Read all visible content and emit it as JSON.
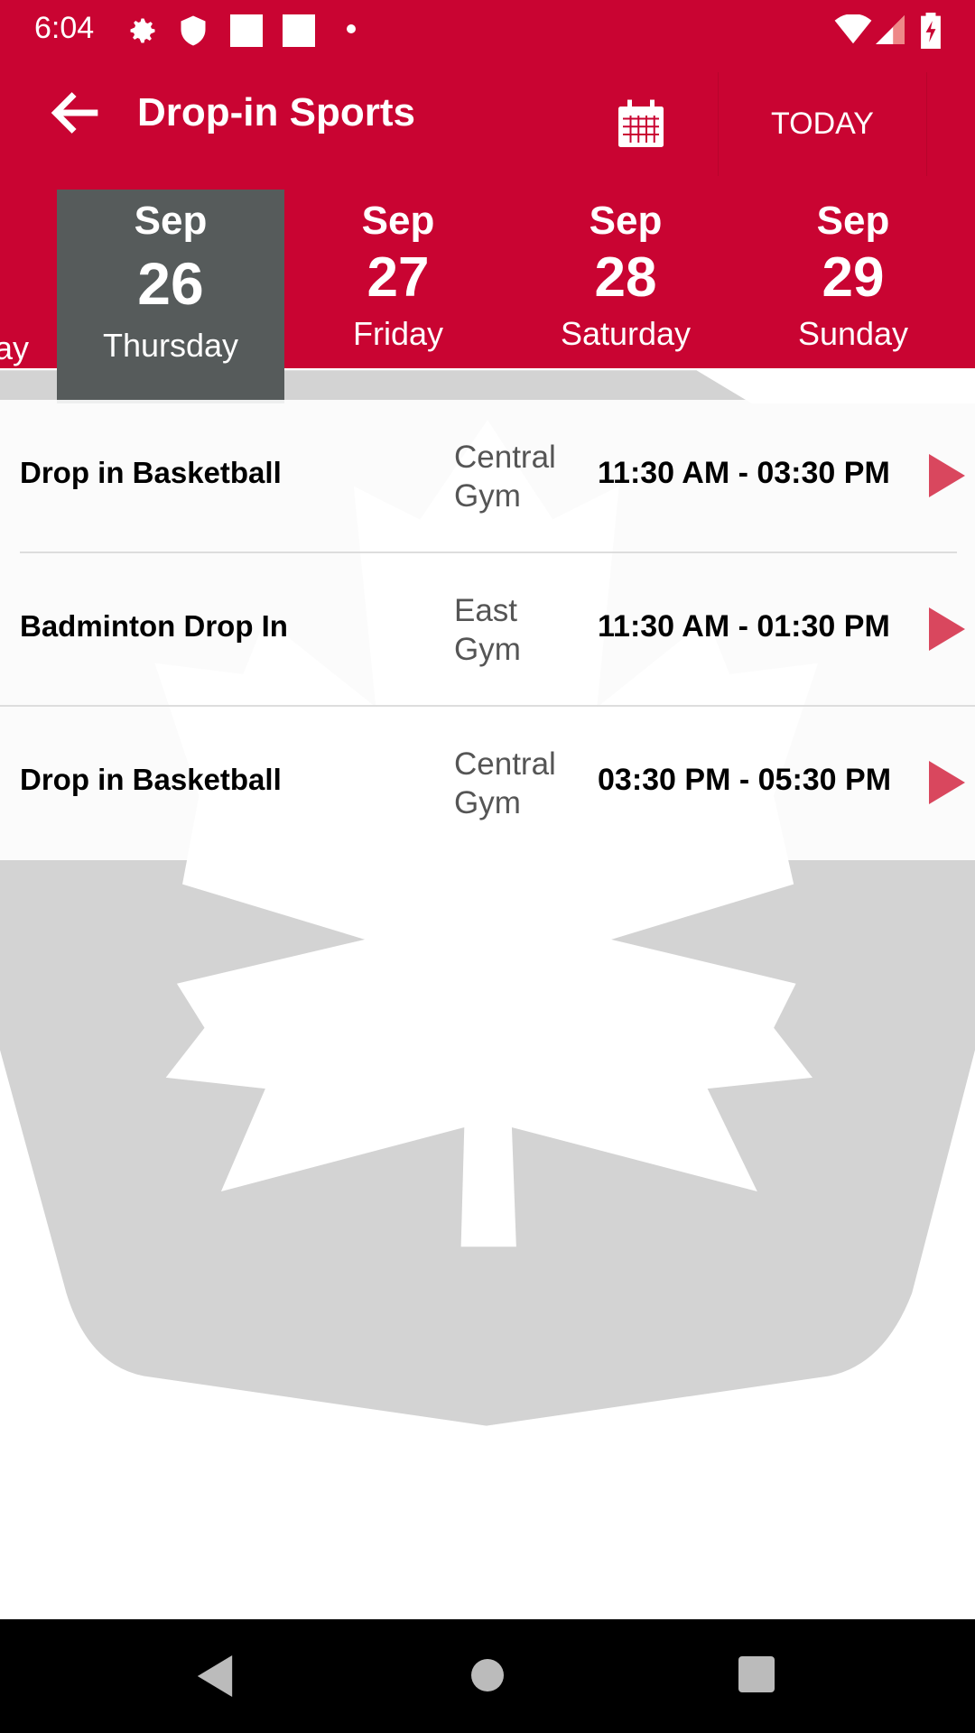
{
  "status_bar": {
    "time": "6:04",
    "icons": [
      "gear-icon",
      "shield-icon",
      "urec-app-icon",
      "recreation-app-icon",
      "dot-icon",
      "wifi-icon",
      "signal-icon",
      "battery-charging-icon"
    ]
  },
  "toolbar": {
    "title": "Drop-in Sports",
    "today_label": "TODAY",
    "back_icon": "arrow-left-icon",
    "calendar_icon": "calendar-icon"
  },
  "date_strip": {
    "partial_label": "ay",
    "days": [
      {
        "month": "Sep",
        "day": "26",
        "weekday": "Thursday",
        "selected": true
      },
      {
        "month": "Sep",
        "day": "27",
        "weekday": "Friday",
        "selected": false
      },
      {
        "month": "Sep",
        "day": "28",
        "weekday": "Saturday",
        "selected": false
      },
      {
        "month": "Sep",
        "day": "29",
        "weekday": "Sunday",
        "selected": false
      }
    ]
  },
  "events": [
    {
      "name": "Drop in Basketball",
      "location": [
        "Central",
        "Gym"
      ],
      "time": "11:30 AM - 03:30 PM"
    },
    {
      "name": "Badminton Drop In",
      "location": [
        "East",
        "Gym"
      ],
      "time": "11:30 AM - 01:30 PM"
    },
    {
      "name": "Drop in Basketball",
      "location": [
        "Central",
        "Gym"
      ],
      "time": "03:30 PM - 05:30 PM"
    }
  ],
  "colors": {
    "brand": "#C90432",
    "selected_day": "#565B5B",
    "play": "#D9475E",
    "watermark": "#D3D3D3"
  }
}
